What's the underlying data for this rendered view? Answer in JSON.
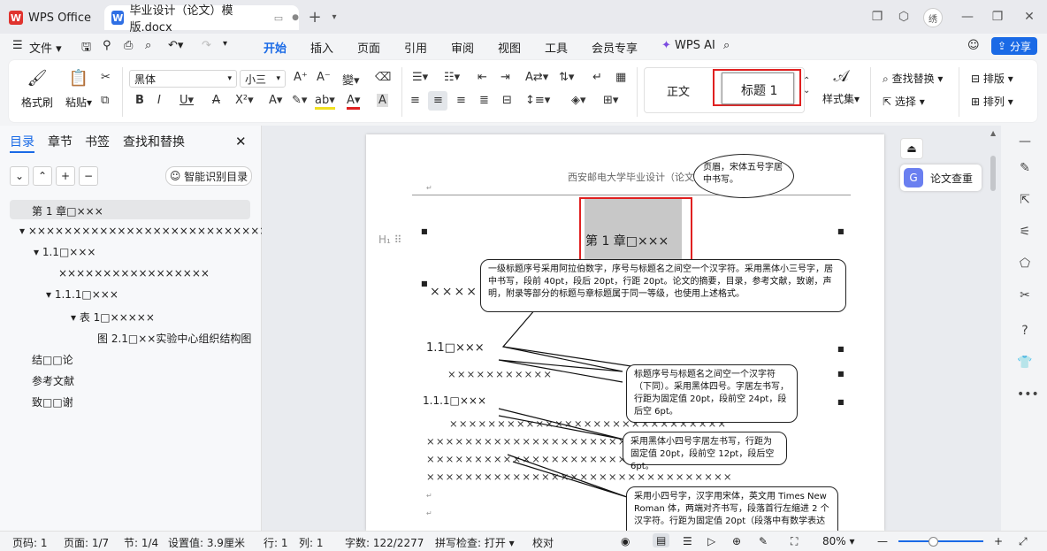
{
  "titlebar": {
    "app_tab": "WPS Office",
    "doc_tab": "毕业设计（论文）模版.docx",
    "avatar_text": "绣"
  },
  "menu": {
    "file": "文件",
    "items": [
      "开始",
      "插入",
      "页面",
      "引用",
      "审阅",
      "视图",
      "工具",
      "会员专享"
    ],
    "wps_ai": "WPS AI",
    "share": "分享"
  },
  "ribbon": {
    "format_painter": "格式刷",
    "paste": "粘贴",
    "font_name": "黑体",
    "font_size": "小三",
    "style_normal": "正文",
    "style_heading": "标题 1",
    "styles_set": "样式集",
    "find_replace": "查找替换",
    "select": "选择",
    "layout": "排版",
    "arrange": "排列"
  },
  "leftpanel": {
    "tabs": [
      "目录",
      "章节",
      "书签",
      "查找和替换"
    ],
    "smart_toc": "智能识别目录",
    "tree": [
      "第 1 章□×××",
      "××××××××××××××××××××××××××××...",
      "1.1□×××",
      "×××××××××××××××××",
      "1.1.1□×××",
      "表 1□×××××",
      "图 2.1□××实验中心组织结构图",
      "结□□论",
      "参考文献",
      "致□□谢"
    ]
  },
  "document": {
    "header_text": "西安邮电大学毕业设计（论文",
    "chapter_title": "第 1 章□×××",
    "left_xs": "××××",
    "sec1": "1.1□×××",
    "sec2": "1.1.1□×××",
    "xs_row1": "×××××××××××××××××××××××××××××",
    "xs_row2": "××××××××××××××××××××××××××××××××",
    "xs_row3": "××××××××××××××××××××××××××××××××",
    "xs_row4": "××××××××××××××××××××××××××××××××",
    "hidden_xs": "×××××××××××",
    "callouts": {
      "header": "页眉，宋体五号字居中书写。",
      "level1": "一级标题序号采用阿拉伯数字，序号与标题名之间空一个汉字符。采用黑体小三号字，居中书写，段前 40pt，段后 20pt，行距 20pt。论文的摘要，目录，参考文献，致谢，声明，附录等部分的标题与章标题属于同一等级，也使用上述格式。",
      "level2": "标题序号与标题名之间空一个汉字符（下同）。采用黑体四号。字居左书写，行距为固定值 20pt，段前空 24pt，段后空 6pt。",
      "level3": "采用黑体小四号字居左书写，行距为固定值 20pt，段前空 12pt，段后空 6pt。",
      "body": "采用小四号字，汉字用宋体，英文用 Times New Roman 体，两端对齐书写，段落首行左缩进 2 个汉字符。行距为固定值 20pt（段落中有数学表达"
    }
  },
  "side_panel": {
    "plagiarism_check": "论文查重"
  },
  "status": {
    "page_num": "页码: 1",
    "pages": "页面: 1/7",
    "section": "节: 1/4",
    "setting": "设置值: 3.9厘米",
    "row": "行: 1",
    "col": "列: 1",
    "word_count": "字数: 122/2277",
    "spell_check": "拼写检查: 打开",
    "proofread": "校对",
    "zoom": "80%"
  },
  "colors": {
    "accent": "#1a6ae6",
    "highlight_box": "#e02020",
    "heading_bg": "#c8c8c8"
  }
}
